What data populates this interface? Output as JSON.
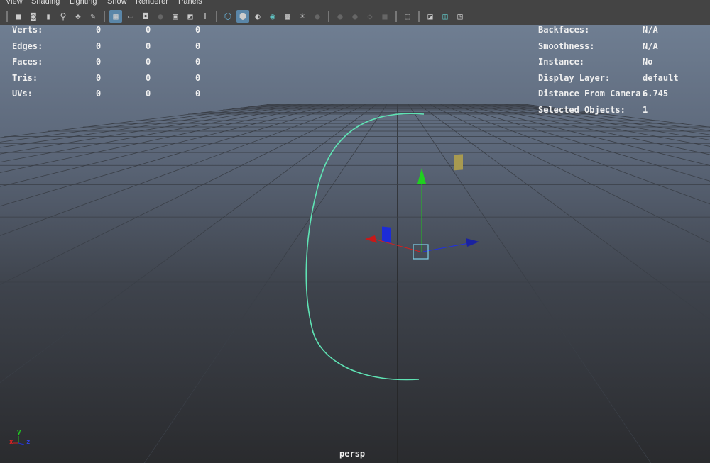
{
  "menu": [
    "View",
    "Shading",
    "Lighting",
    "Show",
    "Renderer",
    "Panels"
  ],
  "stats": {
    "rows": [
      {
        "label": "Verts:",
        "values": [
          "0",
          "0",
          "0"
        ]
      },
      {
        "label": "Edges:",
        "values": [
          "0",
          "0",
          "0"
        ]
      },
      {
        "label": "Faces:",
        "values": [
          "0",
          "0",
          "0"
        ]
      },
      {
        "label": "Tris:",
        "values": [
          "0",
          "0",
          "0"
        ]
      },
      {
        "label": "UVs:",
        "values": [
          "0",
          "0",
          "0"
        ]
      }
    ]
  },
  "info": {
    "rows": [
      {
        "label": "Backfaces:",
        "value": "N/A"
      },
      {
        "label": "Smoothness:",
        "value": "N/A"
      },
      {
        "label": "Instance:",
        "value": "No"
      },
      {
        "label": "Display Layer:",
        "value": "default"
      },
      {
        "label": "Distance From Camera:",
        "value": "6.745"
      },
      {
        "label": "Selected Objects:",
        "value": "1"
      }
    ]
  },
  "camera_label": "persp",
  "axis": {
    "x": "x",
    "y": "y",
    "z": "z"
  },
  "colors": {
    "curve": "#5fe3b4",
    "x_axis": "#d02020",
    "y_axis": "#20c020",
    "z_axis": "#2030d0",
    "selection": "#7fd0e8"
  }
}
